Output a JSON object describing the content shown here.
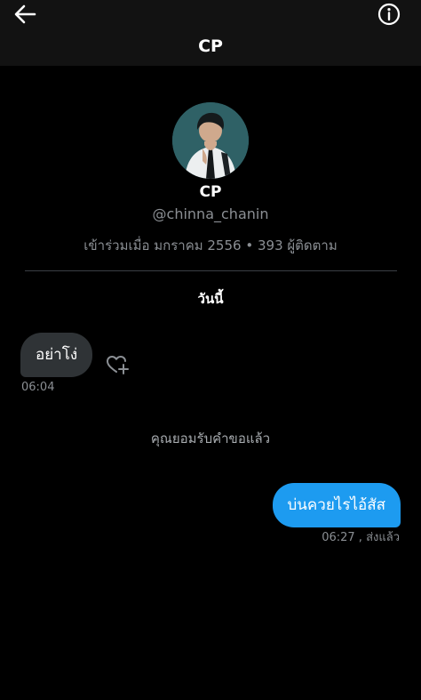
{
  "header": {
    "title": "CP",
    "back_icon": "arrow-left-icon",
    "info_icon": "info-circle-icon"
  },
  "profile": {
    "name": "CP",
    "handle": "@chinna_chanin",
    "joined": "เข้าร่วมเมื่อ มกราคม 2556",
    "separator": "•",
    "followers": "393 ผู้ติดตาม"
  },
  "conversation": {
    "date_label": "วันนี้",
    "messages": [
      {
        "direction": "incoming",
        "text": "อย่าโง่",
        "time": "06:04",
        "reaction_icon": "heart-add-icon"
      },
      {
        "direction": "outgoing",
        "text": "บ่นควยไรไอ้สัส",
        "time": "06:27 , ส่งแล้ว"
      }
    ],
    "system_message": "คุณยอมรับคำขอแล้ว"
  },
  "colors": {
    "background": "#000000",
    "topbar": "#121212",
    "incoming_bubble": "#2f3336",
    "outgoing_bubble": "#1d9bf0",
    "secondary_text": "#8b8f94"
  }
}
